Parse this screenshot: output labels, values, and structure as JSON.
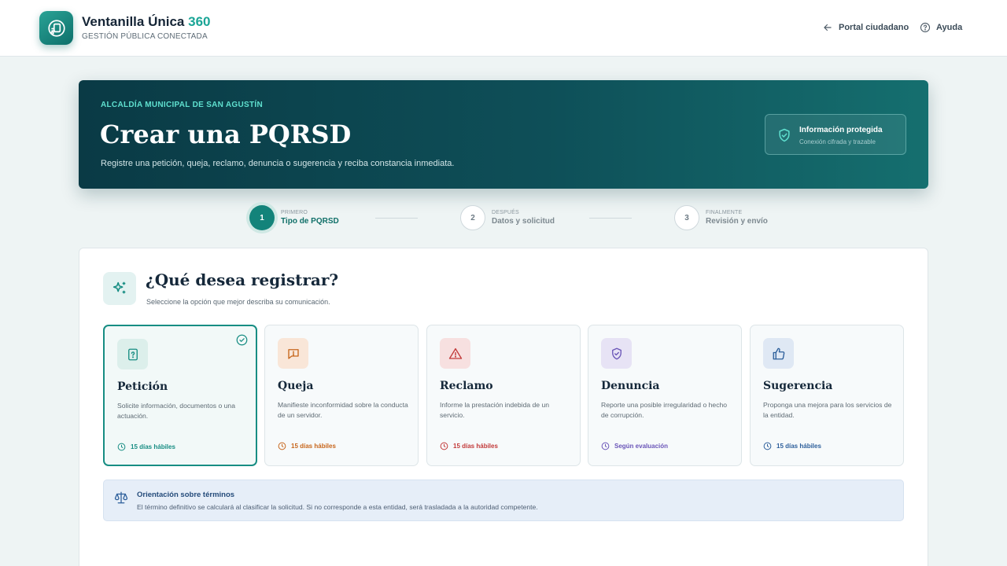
{
  "header": {
    "brand_name": "Ventanilla Única",
    "brand_number": "360",
    "brand_tagline": "GESTIÓN PÚBLICA CONECTADA",
    "nav": {
      "portal_label": "Portal ciudadano",
      "help_label": "Ayuda"
    }
  },
  "hero": {
    "eyebrow": "ALCALDÍA MUNICIPAL DE SAN AGUSTÍN",
    "title": "Crear una PQRSD",
    "description": "Registre una petición, queja, reclamo, denuncia o sugerencia y reciba constancia inmediata.",
    "security": {
      "title": "Información protegida",
      "subtitle": "Conexión cifrada y trazable"
    }
  },
  "stepper": {
    "steps": [
      {
        "number": "1",
        "kicker": "PRIMERO",
        "label": "Tipo de PQRSD",
        "state": "active"
      },
      {
        "number": "2",
        "kicker": "DESPUÉS",
        "label": "Datos y solicitud",
        "state": "pending"
      },
      {
        "number": "3",
        "kicker": "FINALMENTE",
        "label": "Revisión y envío",
        "state": "pending"
      }
    ]
  },
  "main": {
    "title": "¿Qué desea registrar?",
    "subtitle": "Seleccione la opción que mejor describa su comunicación.",
    "options": [
      {
        "title": "Petición",
        "description": "Solicite información, documentos o una actuación.",
        "time": "15 días hábiles",
        "icon": "document-question-icon",
        "accent": "#178d83",
        "icon_bg": "#dcefeb",
        "selected": true
      },
      {
        "title": "Queja",
        "description": "Manifieste inconformidad sobre la conducta de un servidor.",
        "time": "15 días hábiles",
        "icon": "chat-alert-icon",
        "accent": "#c7661c",
        "icon_bg": "#f9e6d8",
        "selected": false
      },
      {
        "title": "Reclamo",
        "description": "Informe la prestación indebida de un servicio.",
        "time": "15 días hábiles",
        "icon": "warning-triangle-icon",
        "accent": "#c23a3a",
        "icon_bg": "#f7e0e0",
        "selected": false
      },
      {
        "title": "Denuncia",
        "description": "Reporte una posible irregularidad o hecho de corrupción.",
        "time": "Según evaluación",
        "icon": "shield-check-icon",
        "accent": "#6a55b8",
        "icon_bg": "#e7e3f5",
        "selected": false
      },
      {
        "title": "Sugerencia",
        "description": "Proponga una mejora para los servicios de la entidad.",
        "time": "15 días hábiles",
        "icon": "thumbs-up-icon",
        "accent": "#2d5f9b",
        "icon_bg": "#dfe8f4",
        "selected": false
      }
    ],
    "notice": {
      "title": "Orientación sobre términos",
      "text": "El término definitivo se calculará al clasificar la solicitud. Si no corresponde a esta entidad, será trasladada a la autoridad competente."
    }
  },
  "colors": {
    "primary": "#13837a",
    "hero_dark": "#0a3a45",
    "hero_accent": "#5fe0cf",
    "brand_accent": "#1aa596"
  }
}
